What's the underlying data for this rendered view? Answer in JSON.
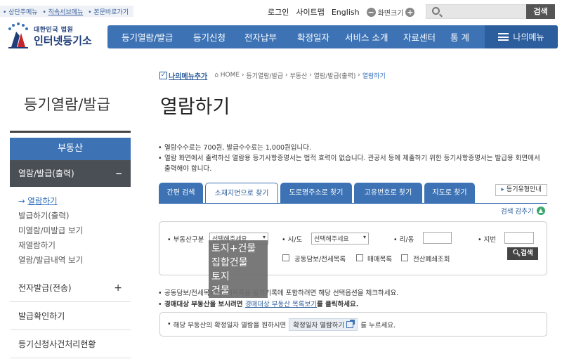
{
  "skip_links": [
    "상단주메뉴",
    "직속서브메뉴",
    "본문바로가기"
  ],
  "util": {
    "login": "로그인",
    "sitemap": "사이트맵",
    "english": "English",
    "font_size": "화면크기",
    "search_button": "검색"
  },
  "logo": {
    "line1": "대한민국 법원",
    "line2": "인터넷등기소"
  },
  "gnb": {
    "items": [
      "등기열람/발급",
      "등기신청",
      "전자납부",
      "확정일자",
      "서비스 소개",
      "자료센터",
      "통 계"
    ],
    "my_menu": "나의메뉴"
  },
  "lnb": {
    "title": "등기열람/발급",
    "category": "부동산",
    "sub_open": "열람/발급(출력)",
    "list": [
      "열람하기",
      "발급하기(출력)",
      "미열람/미발급 보기",
      "재열람하기",
      "열람/발급내역 보기"
    ],
    "groups": [
      "전자발급(전송)",
      "발급확인하기",
      "등기신청사건처리현황"
    ]
  },
  "breadcrumb": {
    "add_menu": "나의메뉴추가",
    "items": [
      "HOME",
      "등기열람/발급",
      "부동산",
      "열람/발급(출력)",
      "열람하기"
    ]
  },
  "page_title": "열람하기",
  "notices": [
    "열람수수료는 700원, 발급수수료는 1,000원입니다.",
    "열람 화면에서 출력하신 열람용 등기사항증명서는 법적 효력이 없습니다. 관공서 등에 제출하기 위한 등기사항증명서는 발급용 화면에서 출력해야 합니다."
  ],
  "tabs": [
    "간편 검색",
    "소재지번으로 찾기",
    "도로명주소로 찾기",
    "고유번호로 찾기",
    "지도로 찾기"
  ],
  "type_guide": "등기유형안내",
  "hide_search": "검색 감추기",
  "form": {
    "realty_type_label": "부동산구분",
    "realty_type_value": "선택해주세요",
    "sido_label": "시/도",
    "sido_value": "선택해주세요",
    "ri_label": "리/동",
    "jibun_label": "지번",
    "checkboxes": [
      "공동담보/전세목록",
      "매매목록",
      "전산폐쇄조회"
    ],
    "search_button": "검색"
  },
  "dropdown_options": [
    "토지+건물",
    "집합건물",
    "토지",
    "건물"
  ],
  "notes": {
    "note1": "공동담보/전세목록, 매매목록을 등기기록에 포함하려면 해당 선택옵션을 체크하세요.",
    "note2_prefix": "경매대상 부동산을 보시려면 ",
    "note2_link": "경매대상 부동산 목록보기",
    "note2_suffix": "를 클릭하세요."
  },
  "info": {
    "prefix": "해당 부동산의 확정일자 열람을 원하시면",
    "button": "확정일자 열람하기",
    "suffix": "를 누르세요."
  }
}
